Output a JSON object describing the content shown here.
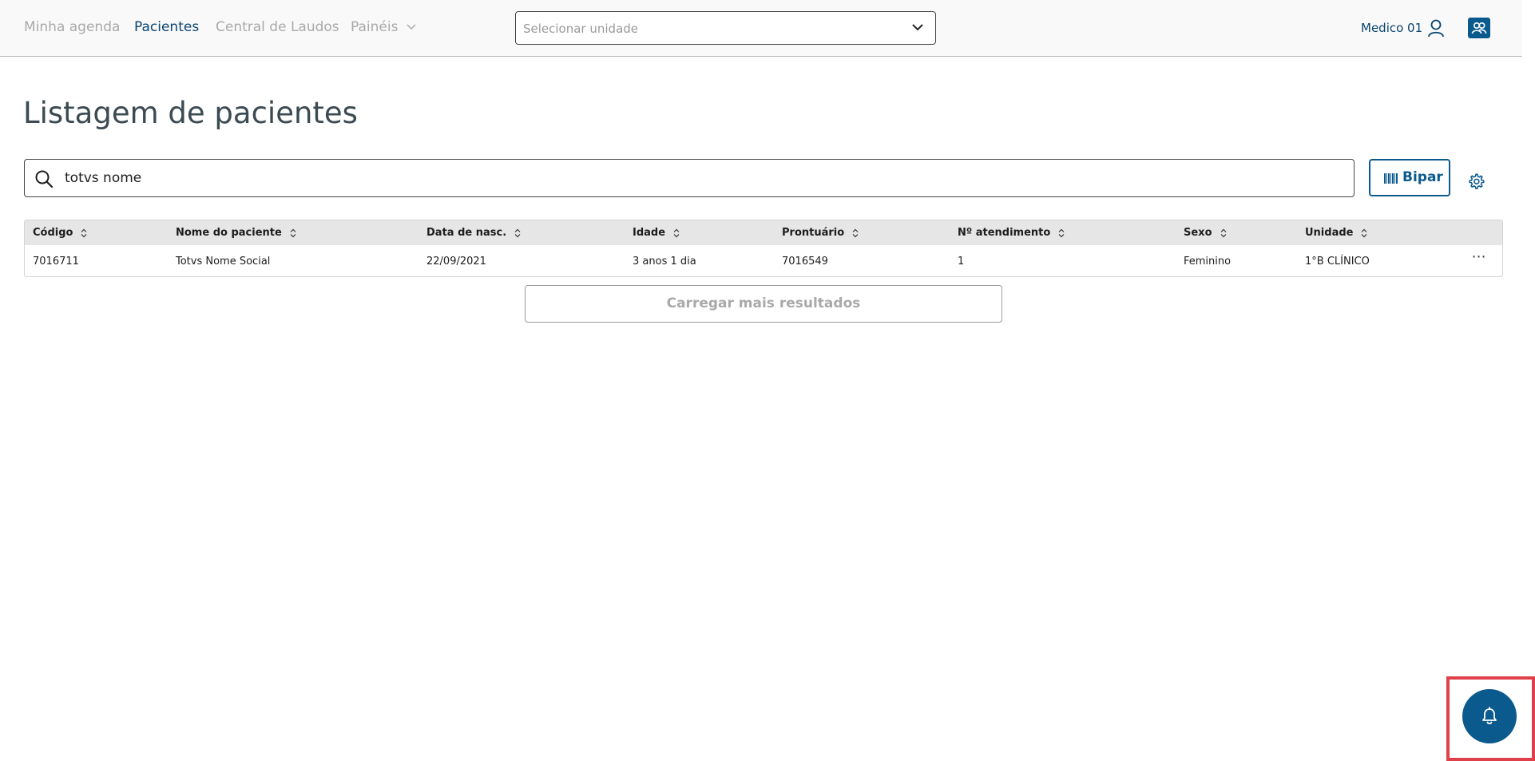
{
  "nav": {
    "items": [
      {
        "label": "Minha agenda",
        "active": false
      },
      {
        "label": "Pacientes",
        "active": true
      },
      {
        "label": "Central de Laudos",
        "active": false
      },
      {
        "label": "Painéis",
        "active": false,
        "has_dropdown": true
      }
    ]
  },
  "unit_select": {
    "placeholder": "Selecionar unidade",
    "icon": "chevron-down-icon"
  },
  "user": {
    "name": "Medico 01",
    "icon": "user-icon"
  },
  "switch_button": {
    "icon": "users-switch-icon"
  },
  "page": {
    "title": "Listagem de pacientes"
  },
  "search": {
    "value": "totvs nome",
    "icon": "search-icon"
  },
  "bipar_button": {
    "label": "Bipar",
    "icon": "barcode-icon"
  },
  "settings": {
    "icon": "gear-icon"
  },
  "table": {
    "columns": [
      "Código",
      "Nome do paciente",
      "Data de nasc.",
      "Idade",
      "Prontuário",
      "Nº atendimento",
      "Sexo",
      "Unidade"
    ],
    "rows": [
      {
        "cells": [
          "7016711",
          "Totvs Nome Social",
          "22/09/2021",
          "3 anos 1 dia",
          "7016549",
          "1",
          "Feminino",
          "1°B CLÍNICO"
        ]
      }
    ],
    "row_action_icon": "more-horizontal-icon"
  },
  "load_more": {
    "label": "Carregar mais resultados"
  },
  "notifications": {
    "icon": "bell-icon"
  },
  "colors": {
    "primary": "#0b5a8e",
    "nav_active": "#0a4470",
    "nav_inactive": "#a9a9a9",
    "highlight_frame": "#e0404a"
  }
}
